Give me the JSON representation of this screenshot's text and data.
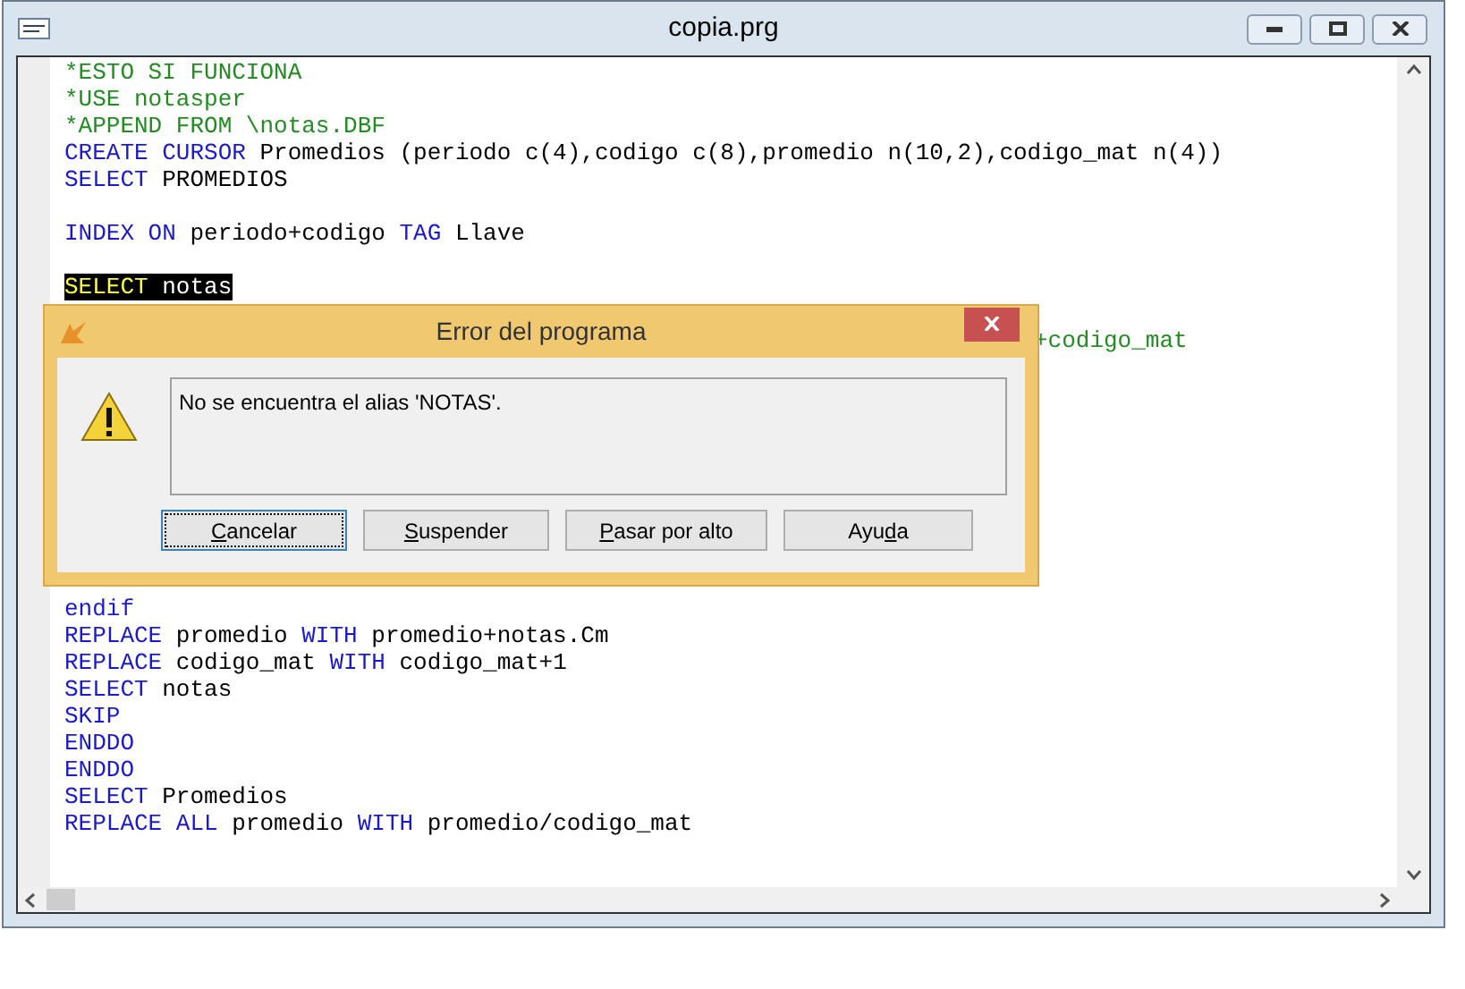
{
  "window": {
    "title": "copia.prg"
  },
  "code": {
    "lines_above": [
      {
        "kind": "code",
        "tokens": [
          {
            "kind": "comment",
            "text": "*ESTO SI FUNCIONA"
          }
        ]
      },
      {
        "kind": "code",
        "tokens": [
          {
            "kind": "comment",
            "text": "*USE notasper"
          }
        ]
      },
      {
        "kind": "code",
        "tokens": [
          {
            "kind": "comment",
            "text": "*APPEND FROM \\notas.DBF"
          }
        ]
      },
      {
        "kind": "code",
        "tokens": [
          {
            "kind": "keyword",
            "text": "CREATE CURSOR"
          },
          {
            "kind": "plain",
            "text": " Promedios (periodo c(4),codigo c(8),promedio n(10,2),codigo_mat n(4))"
          }
        ]
      },
      {
        "kind": "code",
        "tokens": [
          {
            "kind": "keyword",
            "text": "SELECT"
          },
          {
            "kind": "plain",
            "text": " PROMEDIOS"
          }
        ]
      },
      {
        "kind": "blank"
      },
      {
        "kind": "code",
        "tokens": [
          {
            "kind": "keyword",
            "text": "INDEX ON"
          },
          {
            "kind": "plain",
            "text": " periodo+codigo "
          },
          {
            "kind": "keyword",
            "text": "TAG"
          },
          {
            "kind": "plain",
            "text": " Llave"
          }
        ]
      },
      {
        "kind": "blank"
      },
      {
        "kind": "code",
        "tokens": [
          {
            "kind": "highlight_keyword",
            "text": "SELECT"
          },
          {
            "kind": "highlight_plain",
            "text": " notas"
          }
        ]
      }
    ],
    "fragment_beside_dialog": {
      "kind": "comment",
      "text": "+codigo_mat"
    },
    "lines_below": [
      {
        "kind": "code",
        "tokens": [
          {
            "kind": "keyword",
            "text": "endif"
          }
        ]
      },
      {
        "kind": "code",
        "tokens": [
          {
            "kind": "keyword",
            "text": "REPLACE"
          },
          {
            "kind": "plain",
            "text": " promedio "
          },
          {
            "kind": "keyword",
            "text": "WITH"
          },
          {
            "kind": "plain",
            "text": " promedio+notas.Cm"
          }
        ]
      },
      {
        "kind": "code",
        "tokens": [
          {
            "kind": "keyword",
            "text": "REPLACE"
          },
          {
            "kind": "plain",
            "text": " codigo_mat "
          },
          {
            "kind": "keyword",
            "text": "WITH"
          },
          {
            "kind": "plain",
            "text": " codigo_mat+1"
          }
        ]
      },
      {
        "kind": "code",
        "tokens": [
          {
            "kind": "keyword",
            "text": "SELECT"
          },
          {
            "kind": "plain",
            "text": " notas"
          }
        ]
      },
      {
        "kind": "code",
        "tokens": [
          {
            "kind": "keyword",
            "text": "SKIP"
          }
        ]
      },
      {
        "kind": "code",
        "tokens": [
          {
            "kind": "keyword",
            "text": "ENDDO"
          }
        ]
      },
      {
        "kind": "code",
        "tokens": [
          {
            "kind": "keyword",
            "text": "ENDDO"
          }
        ]
      },
      {
        "kind": "code",
        "tokens": [
          {
            "kind": "keyword",
            "text": "SELECT"
          },
          {
            "kind": "plain",
            "text": " Promedios"
          }
        ]
      },
      {
        "kind": "code",
        "tokens": [
          {
            "kind": "keyword",
            "text": "REPLACE ALL"
          },
          {
            "kind": "plain",
            "text": " promedio "
          },
          {
            "kind": "keyword",
            "text": "WITH"
          },
          {
            "kind": "plain",
            "text": " promedio/codigo_mat"
          }
        ]
      }
    ]
  },
  "dialog": {
    "title": "Error del programa",
    "message": "No se encuentra el alias 'NOTAS'.",
    "buttons": [
      {
        "label_parts": [
          {
            "text": "C",
            "underlined": true
          },
          {
            "text": "ancelar",
            "underlined": false
          }
        ],
        "focused": true
      },
      {
        "label_parts": [
          {
            "text": "S",
            "underlined": true
          },
          {
            "text": "uspender",
            "underlined": false
          }
        ],
        "focused": false
      },
      {
        "label_parts": [
          {
            "text": "P",
            "underlined": true
          },
          {
            "text": "asar por alto",
            "underlined": false
          }
        ],
        "focused": false
      },
      {
        "label_parts": [
          {
            "text": "Ayu",
            "underlined": false
          },
          {
            "text": "d",
            "underlined": true
          },
          {
            "text": "a",
            "underlined": false
          }
        ],
        "focused": false
      }
    ]
  }
}
